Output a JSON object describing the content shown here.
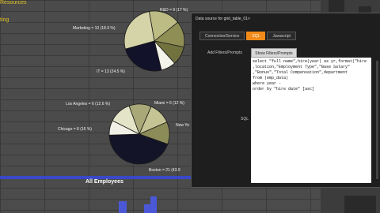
{
  "header": {
    "fragment_title": "Resources",
    "fragment_sub": "ting"
  },
  "pie_top": {
    "labels": {
      "rd": "R&D = 9 (17 %)",
      "marketing": "Marketing = 10 (18.9 %)",
      "it": "IT = 13 (24.5 %)"
    },
    "slices": [
      {
        "value": 17,
        "color": "#bcbc84"
      },
      {
        "value": 14,
        "color": "#8e8e55"
      },
      {
        "value": 10,
        "color": "#72723f"
      },
      {
        "value": 8,
        "color": "#f4f4ea"
      },
      {
        "value": 24.5,
        "color": "#12122a"
      },
      {
        "value": 26.5,
        "color": "#d4d4a8"
      }
    ]
  },
  "pie_bottom": {
    "labels": {
      "la": "Los Angeles = 6 (12.6 %)",
      "miami": "Miami = 6 (12 %)",
      "ny": "New Yo",
      "chicago": "Chicago = 8 (16 %)",
      "boston": "Boston = 21 (43.9"
    },
    "slices": [
      {
        "value": 12,
        "color": "#a8a878"
      },
      {
        "value": 12,
        "color": "#c4c494"
      },
      {
        "value": 12,
        "color": "#8c8c58"
      },
      {
        "value": 44,
        "color": "#141428"
      },
      {
        "value": 8,
        "color": "#f0f0e6"
      },
      {
        "value": 12,
        "color": "#e4e4c8"
      }
    ]
  },
  "chart": {
    "title": "All Employees"
  },
  "dialog": {
    "title": "Data source for grid_table_01>",
    "tabs": [
      "Connection/Service",
      "SQL",
      "Javascript"
    ],
    "active_tab": "SQL",
    "add_filters_label": "Add Filters/Prompts",
    "show_filters_button": "Show Filters/Prompts",
    "sql_label": "SQL",
    "sql_lines": [
      "select \"full name\",hire(year) as yr,format(\"hire",
      ",location,\"Employment Type\",\"Base Salary\"",
      ",\"Bonus\",\"Total Compensation\",department",
      "from (emp_data)",
      "where year -",
      "order by \"hire date\" [asc]"
    ]
  }
}
